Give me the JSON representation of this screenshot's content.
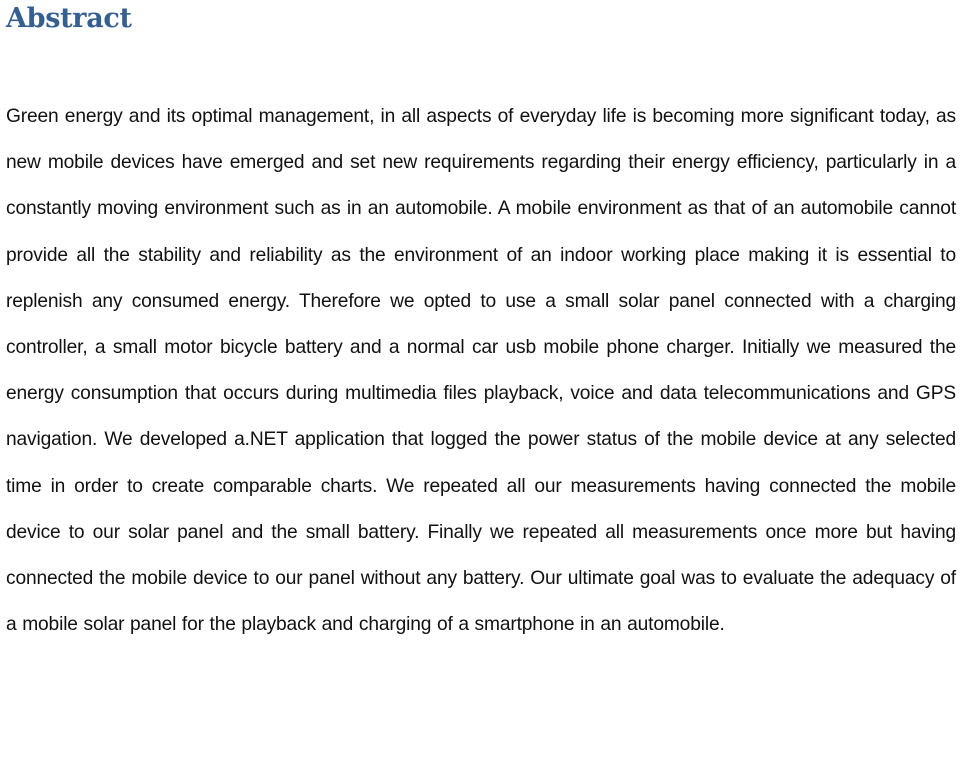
{
  "document": {
    "heading": "Abstract",
    "heading_color": "#365f91",
    "body_text": "Green energy and its optimal management, in all aspects of everyday life is becoming more significant today, as new mobile devices have emerged and set new requirements regarding their energy efficiency, particularly in a constantly moving environment such as in an automobile. A mobile environment as that of an automobile cannot provide all the stability and reliability as the environment of an indoor working place making it is essential to replenish any consumed energy. Therefore we opted to use a small solar panel connected with a charging controller, a small motor bicycle battery and a normal car usb mobile phone charger. Initially we measured the energy consumption that occurs during multimedia files playback, voice and data telecommunications and GPS navigation. We developed a.NET application that logged the power status of the mobile device at any selected time in order to create comparable charts. We repeated all our measurements having connected the mobile device to our solar panel and the small battery. Finally we repeated all measurements once more but having connected the mobile device to our panel without any battery. Our ultimate goal was to evaluate the adequacy of a mobile solar panel for the playback and charging of a smartphone in an automobile."
  }
}
